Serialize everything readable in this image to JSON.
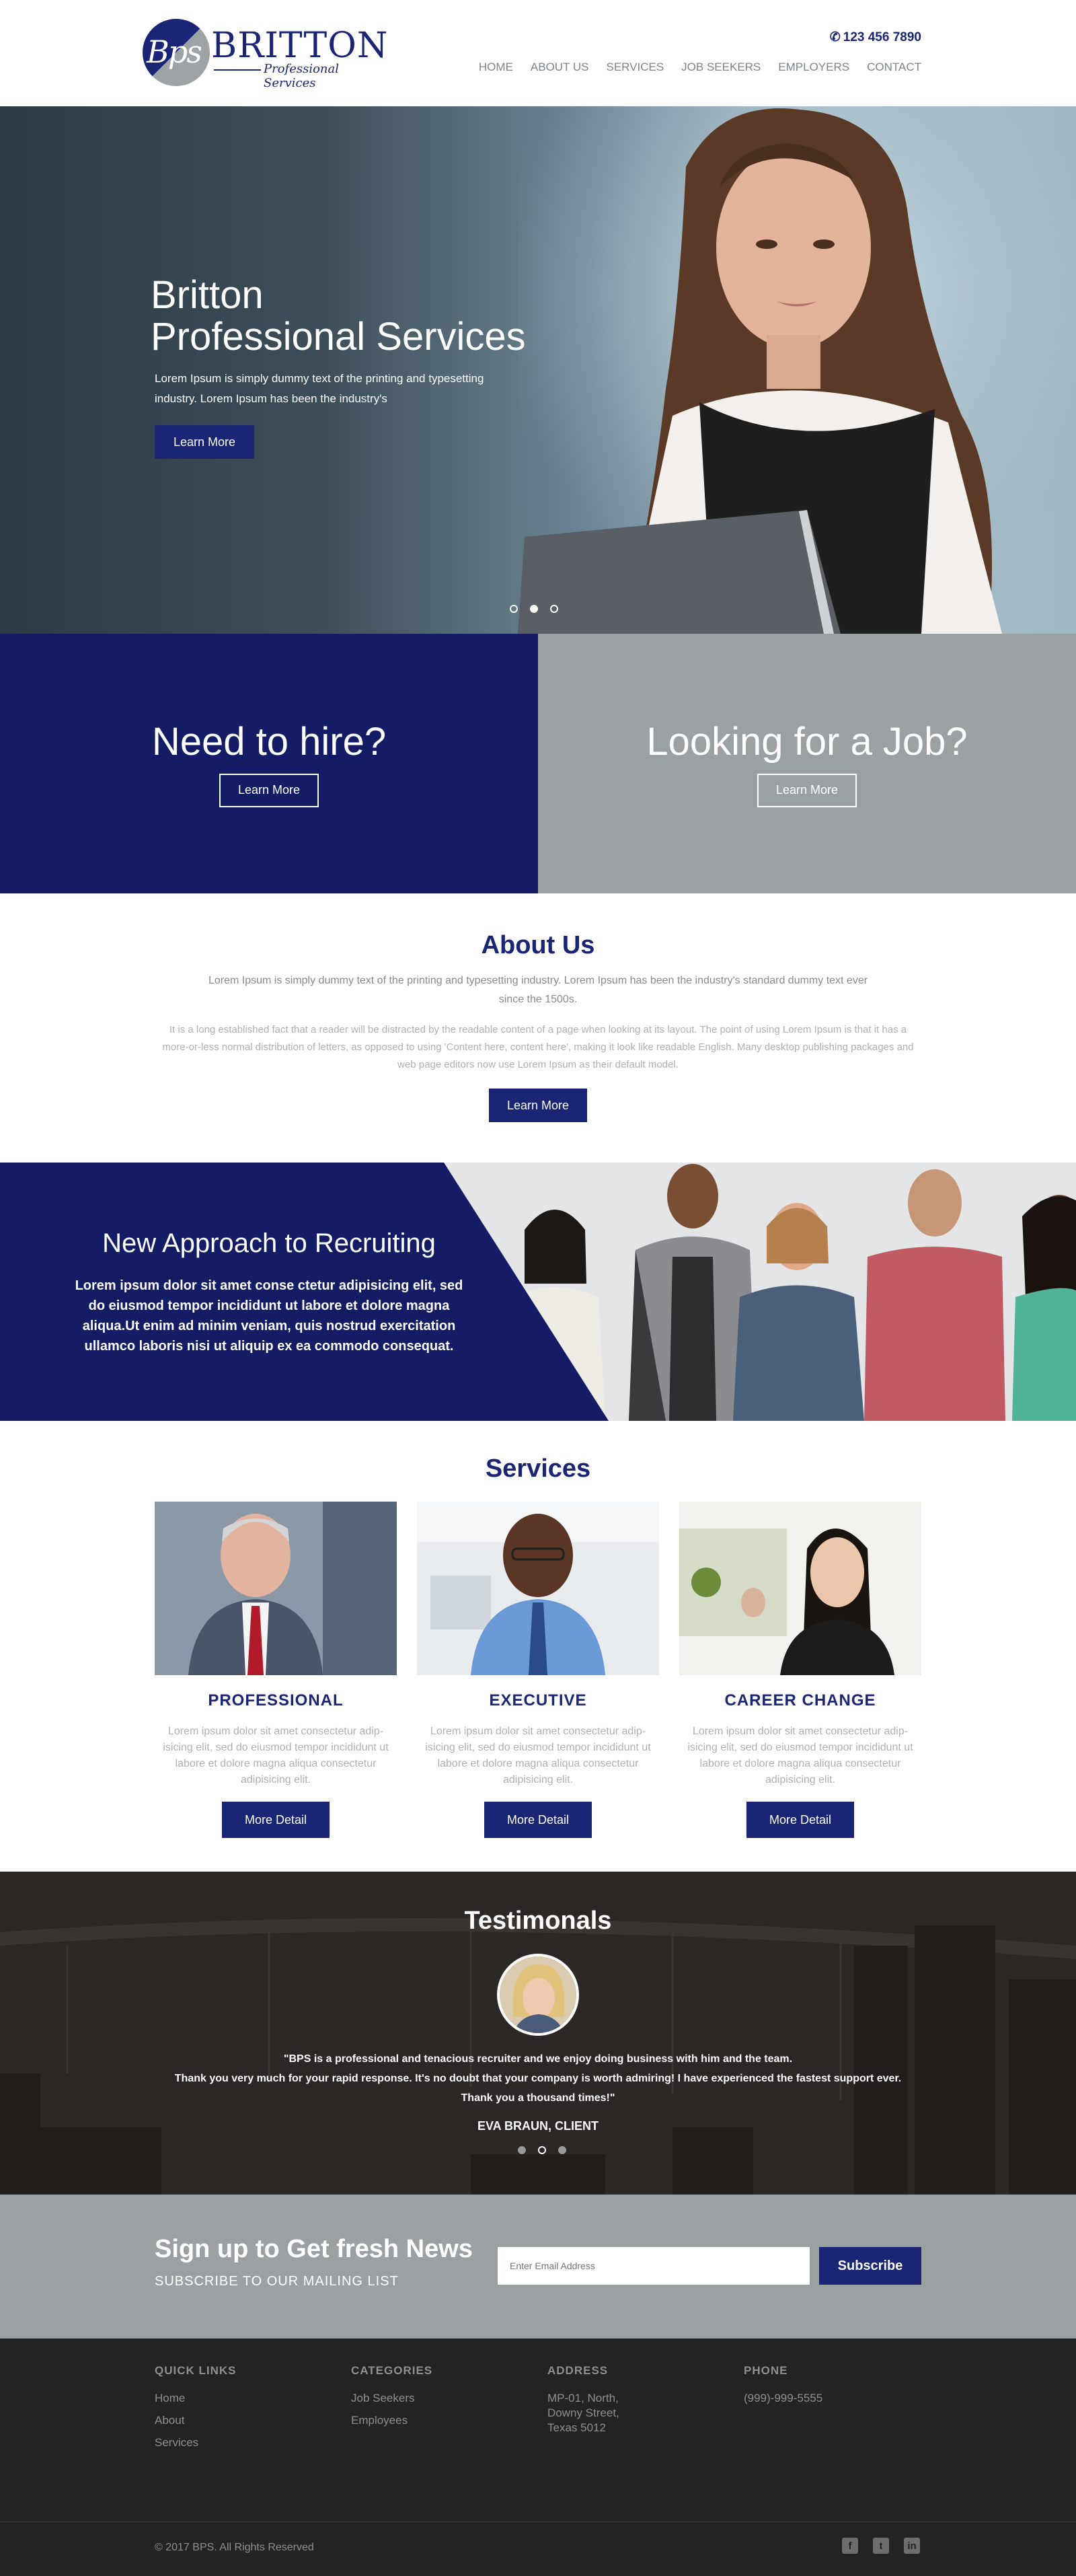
{
  "header": {
    "logo_letters": "Bps",
    "logo_name": "BRITTON",
    "logo_tagline": "Professional Services",
    "phone": "123 456 7890",
    "nav": [
      "HOME",
      "ABOUT US",
      "SERVICES",
      "JOB SEEKERS",
      "EMPLOYERS",
      "CONTACT"
    ]
  },
  "hero": {
    "title_line1": "Britton",
    "title_line2": "Professional Services",
    "text": "Lorem Ipsum is simply dummy text of the printing and typesetting industry. Lorem Ipsum has been the industry's",
    "button": "Learn More",
    "slides": 3,
    "active_slide": 2
  },
  "hire": {
    "title": "Need to hire?",
    "button": "Learn More",
    "color": "#141c66"
  },
  "job": {
    "title": "Looking for a Job?",
    "button": "Learn More",
    "color": "#9ba1a3"
  },
  "about": {
    "title": "About Us",
    "p1": "Lorem Ipsum is simply dummy text of the printing and typesetting industry. Lorem Ipsum has been the industry's standard dummy text ever since the 1500s.",
    "p2": "It is a long established fact that a reader will be distracted by the readable content of a page when looking at its layout. The point of using Lorem Ipsum is that it has a more-or-less normal distribution of letters, as opposed to using 'Content here, content here', making it look like readable English. Many desktop publishing packages and web page editors now use Lorem Ipsum as their default model.",
    "button": "Learn More"
  },
  "approach": {
    "title": "New Approach to Recruiting",
    "text": "Lorem ipsum dolor sit amet conse ctetur adipisicing elit, sed do eiusmod tempor  incididunt ut labore et dolore magna aliqua.Ut enim ad minim veniam, quis nostrud exercitation ullamco laboris nisi ut aliquip ex ea commodo consequat."
  },
  "services": {
    "title": "Services",
    "cards": [
      {
        "title": "PROFESSIONAL",
        "text": "Lorem ipsum dolor sit amet consectetur adip-isicing elit, sed do eiusmod tempor incididunt ut labore et dolore magna aliqua consectetur adipisicing elit.",
        "button": "More Detail"
      },
      {
        "title": "EXECUTIVE",
        "text": "Lorem ipsum dolor sit amet consectetur adip-isicing elit, sed do eiusmod tempor incididunt ut labore et dolore magna aliqua consectetur adipisicing elit.",
        "button": "More Detail"
      },
      {
        "title": "CAREER CHANGE",
        "text": "Lorem ipsum dolor sit amet consectetur adip-isicing elit, sed do eiusmod tempor incididunt ut labore et dolore magna aliqua consectetur adipisicing elit.",
        "button": "More Detail"
      }
    ]
  },
  "testimonials": {
    "title": "Testimonals",
    "quote_line1": "\"BPS is a professional and tenacious recruiter and we enjoy doing business with him and the team.",
    "quote_line2": "Thank you very much for your rapid response. It's no doubt that your company is worth admiring! I have experienced the fastest support ever.",
    "quote_line3": "Thank you a thousand times!\"",
    "client": "EVA BRAUN, CLIENT",
    "active_slide": 2
  },
  "signup": {
    "title": "Sign up to Get fresh News",
    "subtitle": "SUBSCRIBE TO OUR MAILING LIST",
    "email_placeholder": "Enter Email Address",
    "button": "Subscribe"
  },
  "footer": {
    "quick_links": {
      "title": "QUICK LINKS",
      "items": [
        "Home",
        "About",
        "Services"
      ]
    },
    "categories": {
      "title": "CATEGORIES",
      "items": [
        "Job Seekers",
        "Employees"
      ]
    },
    "address": {
      "title": "ADDRESS",
      "lines": [
        "MP-01, North,",
        "Downy Street,",
        "Texas 5012"
      ]
    },
    "phone": {
      "title": "PHONE",
      "value": "(999)-999-5555"
    },
    "copyright": "© 2017 BPS. All Rights Reserved",
    "social": [
      "facebook-icon",
      "twitter-icon",
      "linkedin-icon"
    ]
  },
  "colors": {
    "brand_navy": "#1b2575",
    "gray": "#9ba1a3",
    "footer": "#232323"
  }
}
